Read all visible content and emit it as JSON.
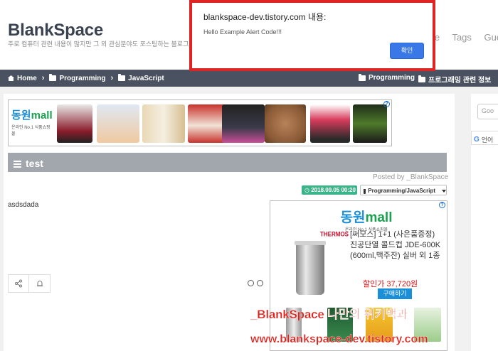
{
  "header": {
    "site_title": "BlankSpace",
    "site_description": "주로 컴퓨터 관련 내용이 많지만 그 외 관심분야도 포스팅하는 블로그",
    "top_menu": [
      "me",
      "Tags",
      "Gue"
    ]
  },
  "navbar": {
    "breadcrumbs": [
      "Home",
      "Programming",
      "JavaScript"
    ],
    "right_links": [
      "Programming",
      "프로그래밍 관련 정보"
    ]
  },
  "sidebar": {
    "search_placeholder": "Goo",
    "translate_label": "언어"
  },
  "ad_top": {
    "brand_main": "동원",
    "brand_mall": "mall",
    "brand_sub": "온라인 No.1 식품쇼핑몰",
    "info_glyph": "?"
  },
  "post": {
    "title": "test",
    "posted_by": "Posted by _BlankSpace",
    "date": "2018.09.05 00:20",
    "category": "Programming/JavaScript",
    "body": "asdsdada"
  },
  "ad_product": {
    "brand_main": "동원",
    "brand_mall": "mall",
    "brand_sub": "온라인 No.1 식품쇼핑몰",
    "maker": "THERMOS",
    "description": "[써모스] 1+1 (사은품증정) 진공단열 콜드컵 JDE-600K (600ml,맥주잔) 실버 외 1종",
    "price": "할인가  37,720원",
    "buy_label": "구매하기",
    "info_glyph": "?"
  },
  "watermark": {
    "line1": "_BlankSpace 나만의 위키백과",
    "line2": "www.blankspace-dev.tistory.com"
  },
  "alert": {
    "title": "blankspace-dev.tistory.com 내용:",
    "message": "Hello Example Alert Code!!!",
    "ok_label": "확인"
  },
  "colors": {
    "navbar": "#4a5261",
    "date_badge": "#3cb48a",
    "alert_border": "#e02424",
    "alert_button": "#3a78e7",
    "watermark": "#e0201a"
  }
}
